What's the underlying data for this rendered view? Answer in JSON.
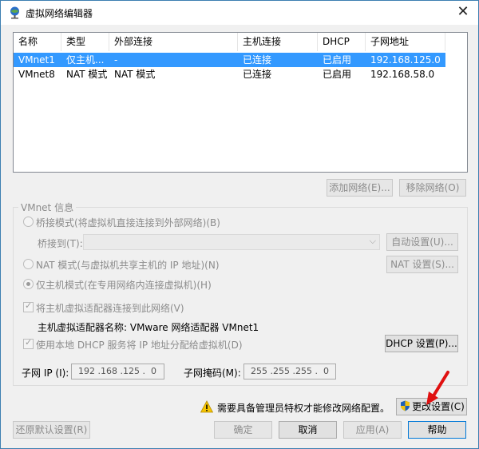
{
  "window": {
    "title": "虚拟网络编辑器",
    "close_glyph": "✕"
  },
  "table": {
    "columns": [
      "名称",
      "类型",
      "外部连接",
      "主机连接",
      "DHCP",
      "子网地址"
    ],
    "rows": [
      [
        "VMnet1",
        "仅主机...",
        "-",
        "已连接",
        "已启用",
        "192.168.125.0"
      ],
      [
        "VMnet8",
        "NAT 模式",
        "NAT 模式",
        "已连接",
        "已启用",
        "192.168.58.0"
      ]
    ],
    "selected_index": 0
  },
  "list_buttons": {
    "add_network": "添加网络(E)...",
    "remove_network": "移除网络(O)"
  },
  "vmnet_info": {
    "group_title": "VMnet 信息",
    "bridged_label": "桥接模式(将虚拟机直接连接到外部网络)(B)",
    "bridged_to_label": "桥接到(T):",
    "bridged_to_value": "",
    "auto_settings_button": "自动设置(U)...",
    "nat_label": "NAT 模式(与虚拟机共享主机的 IP 地址)(N)",
    "nat_settings_button": "NAT 设置(S)...",
    "hostonly_label": "仅主机模式(在专用网络内连接虚拟机)(H)",
    "selected_mode": "hostonly",
    "connect_adapter_label": "将主机虚拟适配器连接到此网络(V)",
    "connect_adapter_checked": true,
    "adapter_name_label": "主机虚拟适配器名称: VMware 网络适配器 VMnet1",
    "dhcp_label": "使用本地 DHCP 服务将 IP 地址分配给虚拟机(D)",
    "dhcp_checked": true,
    "dhcp_settings_button": "DHCP 设置(P)...",
    "subnet_ip_label": "子网 IP (I):",
    "subnet_ip_value": "192 .168 .125 .  0",
    "subnet_mask_label": "子网掩码(M):",
    "subnet_mask_value": "255 .255 .255 .  0"
  },
  "admin_notice": {
    "text": "需要具备管理员特权才能修改网络配置。",
    "change_settings_button": "更改设置(C)"
  },
  "footer": {
    "restore_defaults": "还原默认设置(R)",
    "ok": "确定",
    "cancel": "取消",
    "apply": "应用(A)",
    "help": "帮助"
  },
  "colors": {
    "selection": "#3399ff",
    "annotation_arrow": "#e01010",
    "window_border": "#3c7fb1"
  }
}
